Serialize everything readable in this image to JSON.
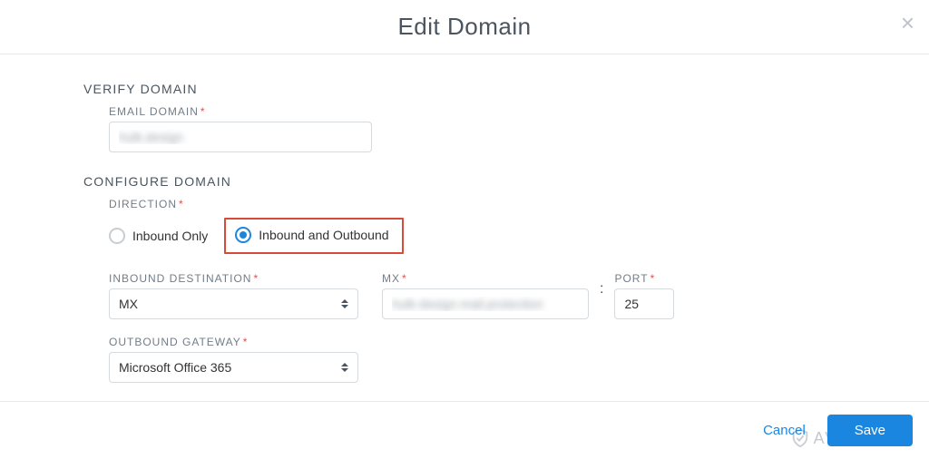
{
  "modal": {
    "title": "Edit Domain",
    "close_label": "×"
  },
  "verify": {
    "section": "VERIFY DOMAIN",
    "email_domain_label": "EMAIL DOMAIN",
    "email_domain_value": "hulk.design"
  },
  "configure": {
    "section": "CONFIGURE DOMAIN",
    "direction": {
      "label": "DIRECTION",
      "inbound_only": "Inbound Only",
      "inbound_outbound": "Inbound and Outbound",
      "selected": "inbound_outbound"
    },
    "inbound_destination": {
      "label": "INBOUND DESTINATION",
      "value": "MX"
    },
    "mx": {
      "label": "MX",
      "value": "hulk-design.mail.protection"
    },
    "port": {
      "label": "PORT",
      "value": "25"
    },
    "outbound_gateway": {
      "label": "OUTBOUND GATEWAY",
      "value": "Microsoft Office 365"
    }
  },
  "footer": {
    "cancel": "Cancel",
    "save": "Save"
  },
  "watermark": {
    "text": "AVANET"
  }
}
